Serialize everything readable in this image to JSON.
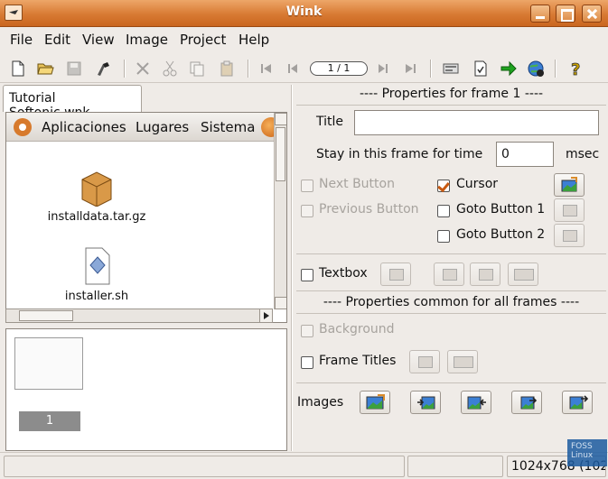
{
  "window": {
    "title": "Wink"
  },
  "menu": [
    "File",
    "Edit",
    "View",
    "Image",
    "Project",
    "Help"
  ],
  "toolbar": {
    "frame_counter": "1 / 1"
  },
  "tab": {
    "label": "Tutorial Softonic.wnk"
  },
  "viewer": {
    "gnome_menus": [
      "Aplicaciones",
      "Lugares",
      "Sistema"
    ],
    "icons": [
      "installdata.tar.gz",
      "installer.sh"
    ]
  },
  "thumbnails": {
    "frame_number": "1"
  },
  "frame_props": {
    "header": "---- Properties for frame 1 ----",
    "title_label": "Title",
    "title_value": "",
    "stay_label": "Stay in this frame for time",
    "stay_value": "0",
    "stay_unit": "msec",
    "next_button": "Next Button",
    "previous_button": "Previous Button",
    "cursor": "Cursor",
    "goto_button_1": "Goto Button 1",
    "goto_button_2": "Goto Button 2",
    "textbox": "Textbox"
  },
  "common_props": {
    "header": "---- Properties common for all frames ----",
    "background": "Background",
    "frame_titles": "Frame Titles",
    "images": "Images"
  },
  "status": {
    "resolution": "1024x768 (102"
  },
  "watermark": {
    "line1": "FOSS",
    "line2": "Linux"
  },
  "colors": {
    "titlebar": "#d87a33",
    "accent": "#c85a12"
  }
}
